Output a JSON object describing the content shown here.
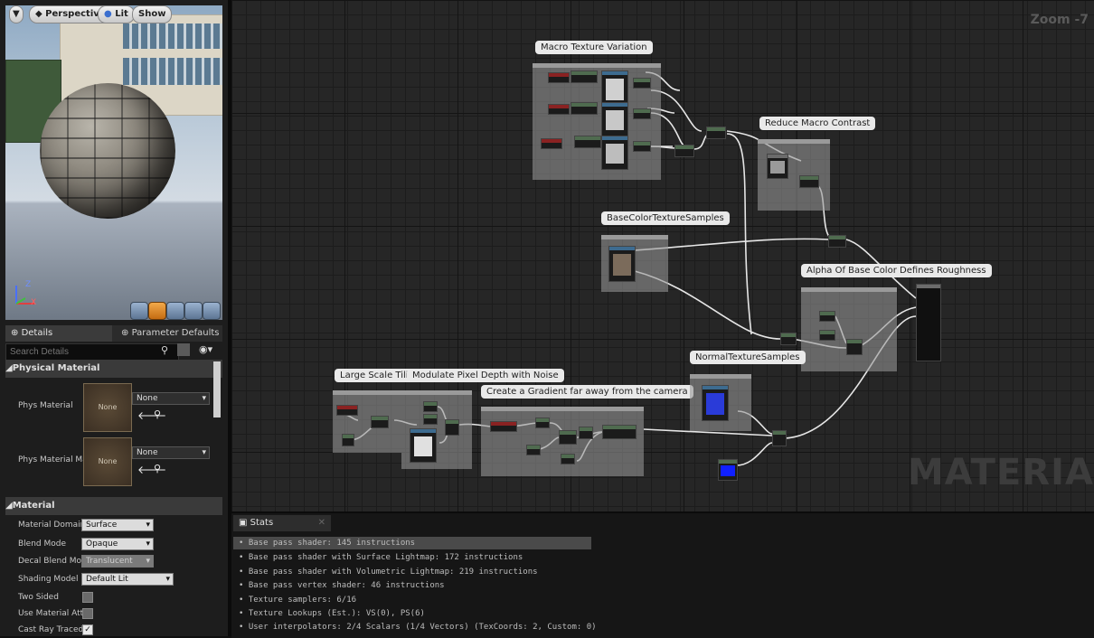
{
  "viewport": {
    "buttons": {
      "menu": "▼",
      "perspective": "Perspective",
      "lit": "Lit",
      "show": "Show"
    },
    "axis": {
      "z": "Z",
      "x": "X"
    }
  },
  "details": {
    "tabs": {
      "details": "Details",
      "params": "Parameter Defaults"
    },
    "search_placeholder": "Search Details",
    "sections": {
      "physical": {
        "title": "Physical Material",
        "rows": [
          {
            "label": "Phys Material",
            "thumb": "None",
            "value": "None"
          },
          {
            "label": "Phys Material Ma",
            "thumb": "None",
            "value": "None"
          }
        ]
      },
      "material": {
        "title": "Material",
        "rows": {
          "domain": {
            "label": "Material Domain",
            "value": "Surface"
          },
          "blend": {
            "label": "Blend Mode",
            "value": "Opaque"
          },
          "decal": {
            "label": "Decal Blend Mode",
            "value": "Translucent"
          },
          "shading": {
            "label": "Shading Model",
            "value": "Default Lit"
          },
          "twosided": {
            "label": "Two Sided"
          },
          "usematerial": {
            "label": "Use Material Attri"
          },
          "castray": {
            "label": "Cast Ray Traced"
          }
        }
      }
    }
  },
  "graph": {
    "zoom": "Zoom -7",
    "watermark": "MATERIAL",
    "comments": {
      "macro": "Macro Texture Variation",
      "reduce": "Reduce Macro Contrast",
      "basecolor": "BaseColorTextureSamples",
      "alpha": "Alpha Of Base Color Defines Roughness",
      "large": "Large Scale Tiling",
      "modulate": "Modulate Pixel Depth with Noise",
      "gradient": "Create a Gradient far away from the camera",
      "normal": "NormalTextureSamples"
    }
  },
  "stats": {
    "tab": "Stats",
    "lines": [
      "Base pass shader: 145 instructions",
      "Base pass shader with Surface Lightmap: 172 instructions",
      "Base pass shader with Volumetric Lightmap: 219 instructions",
      "Base pass vertex shader: 46 instructions",
      "Texture samplers: 6/16",
      "Texture Lookups (Est.): VS(0), PS(6)",
      "User interpolators: 2/4 Scalars (1/4 Vectors) (TexCoords: 2, Custom: 0)"
    ]
  }
}
